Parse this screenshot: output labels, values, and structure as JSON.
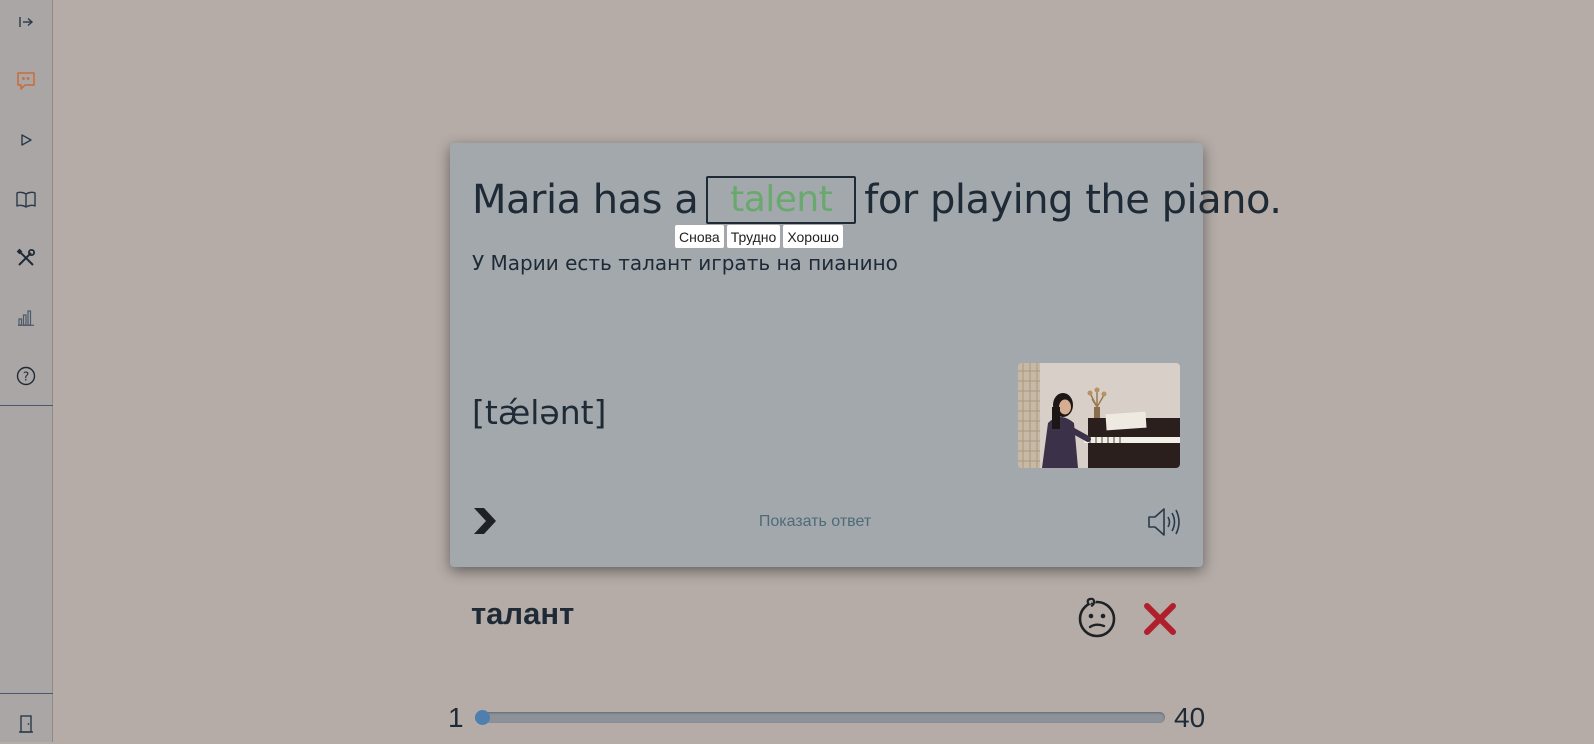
{
  "sidebar": {
    "items": [
      {
        "name": "expand",
        "icon": "expand-arrow-icon"
      },
      {
        "name": "chat",
        "icon": "quote-bubble-icon",
        "color": "#c96a3a"
      },
      {
        "name": "play",
        "icon": "play-icon"
      },
      {
        "name": "book",
        "icon": "book-icon"
      },
      {
        "name": "tools",
        "icon": "tools-icon"
      },
      {
        "name": "stats",
        "icon": "bar-chart-icon"
      },
      {
        "name": "help",
        "icon": "help-icon"
      }
    ],
    "bottom": {
      "name": "exit",
      "icon": "door-icon"
    }
  },
  "card": {
    "sentence_before": "Maria has a",
    "answer": "talent",
    "sentence_after": "for playing the piano.",
    "grade_buttons": [
      "Снова",
      "Трудно",
      "Хорошо"
    ],
    "translation": "У Марии есть талант играть на пианино",
    "transcription": "[tǽlənt]",
    "picture": "woman-playing-piano-photo",
    "show_answer_label": "Показать ответ",
    "colors": {
      "answer": "#6aa96e",
      "card_bg": "#a3a8ac"
    }
  },
  "word": {
    "text": "талант"
  },
  "progress": {
    "start": "1",
    "end": "40",
    "current": 1,
    "total": 40,
    "accent": "#4f7fae"
  }
}
